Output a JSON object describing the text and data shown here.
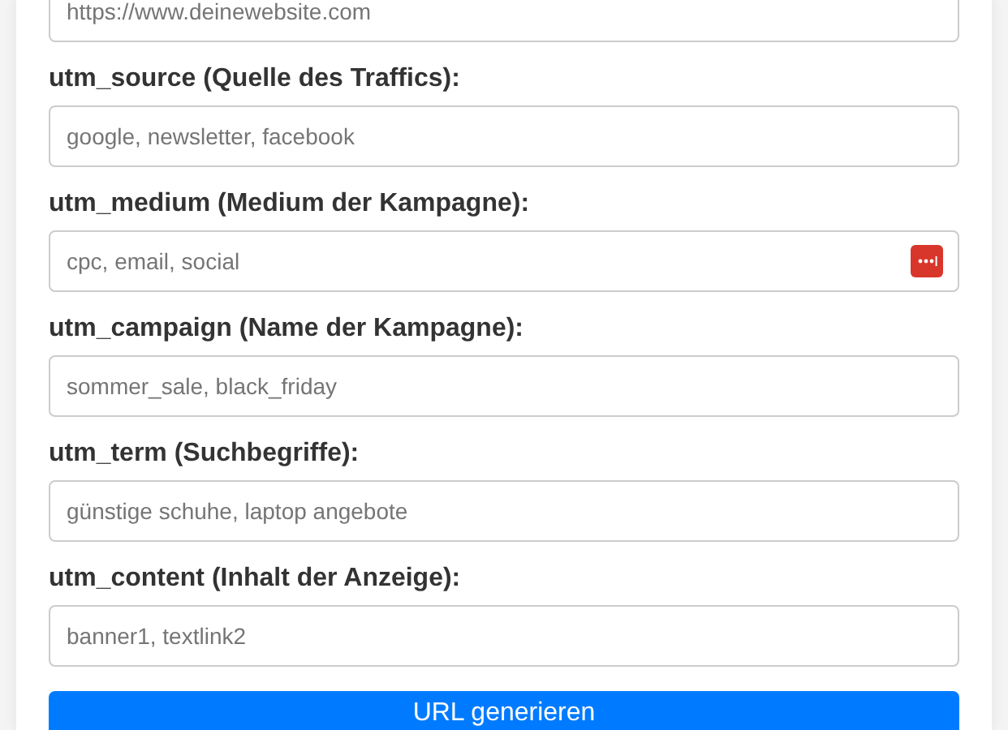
{
  "fields": [
    {
      "placeholder": "https://www.deinewebsite.com",
      "autofill_icon": false
    },
    {
      "label": "utm_source (Quelle des Traffics):",
      "placeholder": "google, newsletter, facebook",
      "autofill_icon": false
    },
    {
      "label": "utm_medium (Medium der Kampagne):",
      "placeholder": "cpc, email, social",
      "autofill_icon": true
    },
    {
      "label": "utm_campaign (Name der Kampagne):",
      "placeholder": "sommer_sale, black_friday",
      "autofill_icon": false
    },
    {
      "label": "utm_term (Suchbegriffe):",
      "placeholder": "günstige schuhe, laptop angebote",
      "autofill_icon": false
    },
    {
      "label": "utm_content (Inhalt der Anzeige):",
      "placeholder": "banner1, textlink2",
      "autofill_icon": false
    }
  ],
  "button": "URL generieren"
}
